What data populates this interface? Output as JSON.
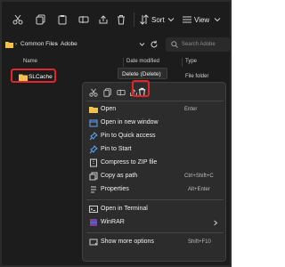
{
  "toolbar": {
    "sort_label": "Sort",
    "view_label": "View"
  },
  "address": {
    "breadcrumb": [
      "Common Files",
      "Adobe"
    ],
    "search_placeholder": "Search Adobe"
  },
  "columns": {
    "name": "Name",
    "date_modified": "Date modified",
    "type": "Type"
  },
  "file": {
    "name": "SLCache",
    "type": "File folder"
  },
  "tooltip": {
    "text": "Delete (Delete)"
  },
  "quick_actions": [
    "cut-icon",
    "copy-icon",
    "rename-icon",
    "share-icon",
    "delete-icon"
  ],
  "menu": [
    {
      "label": "Open",
      "shortcut": "Enter"
    },
    {
      "label": "Open in new window",
      "shortcut": ""
    },
    {
      "label": "Pin to Quick access",
      "shortcut": ""
    },
    {
      "label": "Pin to Start",
      "shortcut": ""
    },
    {
      "label": "Compress to ZIP file",
      "shortcut": ""
    },
    {
      "label": "Copy as path",
      "shortcut": "Ctrl+Shift+C"
    },
    {
      "label": "Properties",
      "shortcut": "Alt+Enter"
    },
    {
      "label": "Open in Terminal",
      "shortcut": ""
    },
    {
      "label": "WinRAR",
      "shortcut": ""
    },
    {
      "label": "Show more options",
      "shortcut": "Shift+F10"
    }
  ],
  "colors": {
    "highlight": "#e0262a",
    "folder": "#f2c14e",
    "accent": "#60a5fa",
    "menu_bg": "#2c2c2c",
    "window_bg": "#1c1c1c"
  }
}
